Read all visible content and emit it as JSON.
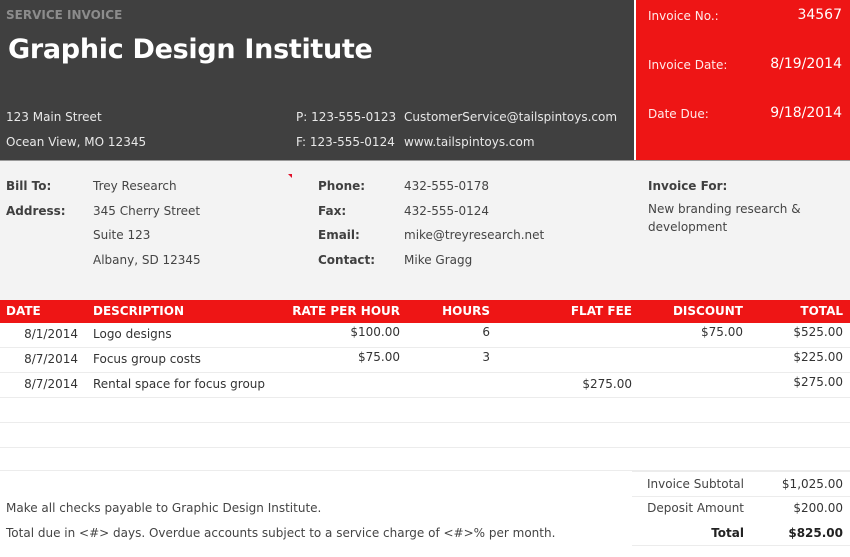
{
  "header": {
    "doc_type": "SERVICE INVOICE",
    "company_name": "Graphic Design Institute",
    "address_line1": "123 Main Street",
    "address_line2": "Ocean View, MO 12345",
    "phone": "P: 123-555-0123",
    "fax": "F: 123-555-0124",
    "email": "CustomerService@tailspintoys.com",
    "website": "www.tailspintoys.com"
  },
  "invoice_info": {
    "number_label": "Invoice No.:",
    "number_value": "34567",
    "date_label": "Invoice Date:",
    "date_value": "8/19/2014",
    "due_label": "Date Due:",
    "due_value": "9/18/2014"
  },
  "bill_to": {
    "bill_to_label": "Bill To:",
    "bill_to_value": "Trey Research",
    "address_label": "Address:",
    "address_line1": "345 Cherry Street",
    "address_line2": "Suite 123",
    "address_line3": "Albany, SD 12345",
    "phone_label": "Phone:",
    "phone_value": "432-555-0178",
    "fax_label": "Fax:",
    "fax_value": "432-555-0124",
    "email_label": "Email:",
    "email_value": "mike@treyresearch.net",
    "contact_label": "Contact:",
    "contact_value": "Mike Gragg",
    "invoice_for_label": "Invoice For:",
    "invoice_for_value": "New branding research & development"
  },
  "table": {
    "columns": [
      "DATE",
      "DESCRIPTION",
      "RATE PER HOUR",
      "HOURS",
      "FLAT FEE",
      "DISCOUNT",
      "TOTAL"
    ],
    "rows": [
      {
        "date": "8/1/2014",
        "description": "Logo designs",
        "rate": "$100.00",
        "hours": "6",
        "flat_fee": "",
        "discount": "$75.00",
        "total": "$525.00"
      },
      {
        "date": "8/7/2014",
        "description": "Focus group costs",
        "rate": "$75.00",
        "hours": "3",
        "flat_fee": "",
        "discount": "",
        "total": "$225.00"
      },
      {
        "date": "8/7/2014",
        "description": "Rental space for focus group",
        "rate": "",
        "hours": "",
        "flat_fee": "$275.00",
        "discount": "",
        "total": "$275.00"
      },
      {
        "date": "",
        "description": "",
        "rate": "",
        "hours": "",
        "flat_fee": "",
        "discount": "",
        "total": ""
      },
      {
        "date": "",
        "description": "",
        "rate": "",
        "hours": "",
        "flat_fee": "",
        "discount": "",
        "total": ""
      },
      {
        "date": "",
        "description": "",
        "rate": "",
        "hours": "",
        "flat_fee": "",
        "discount": "",
        "total": ""
      }
    ]
  },
  "footer": {
    "note1": "Make all checks payable to Graphic Design Institute.",
    "note2": "Total due in <#> days. Overdue accounts subject to a service charge of <#>% per month.",
    "subtotal_label": "Invoice Subtotal",
    "subtotal_value": "$1,025.00",
    "deposit_label": "Deposit Amount",
    "deposit_value": "$200.00",
    "total_label": "Total",
    "total_value": "$825.00"
  },
  "colors": {
    "accent_red": "#ee1515",
    "header_dark": "#404040",
    "billing_bg": "#f3f3f3"
  }
}
